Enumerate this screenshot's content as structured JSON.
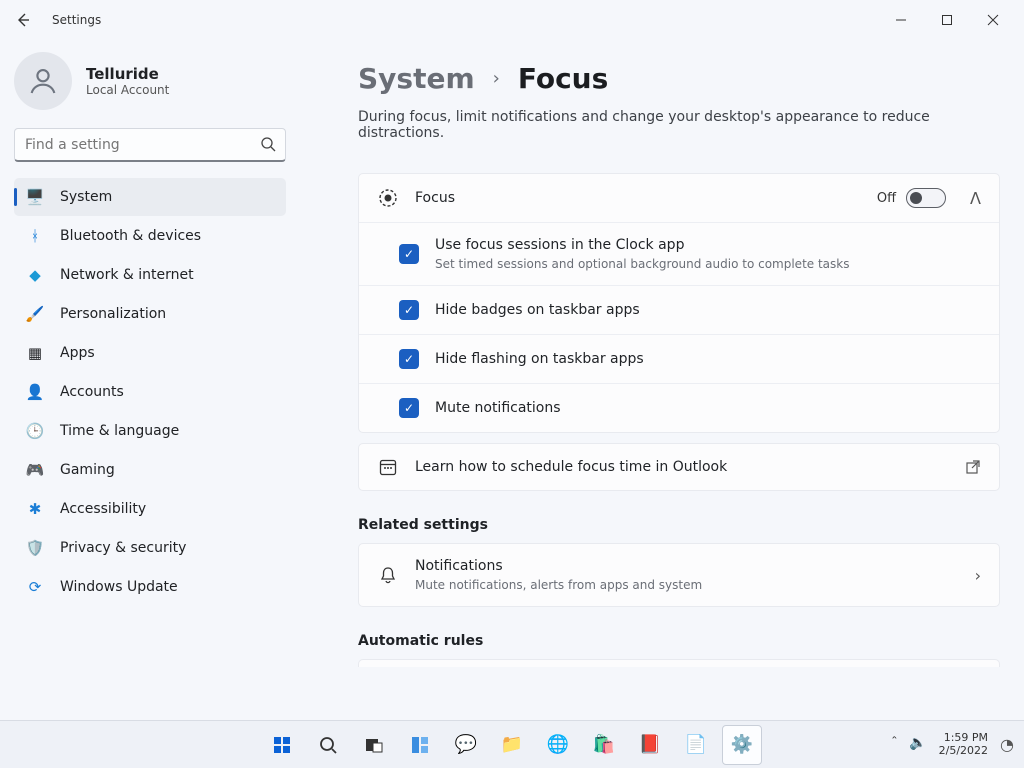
{
  "app": {
    "title": "Settings"
  },
  "user": {
    "name": "Telluride",
    "sub": "Local Account"
  },
  "search": {
    "placeholder": "Find a setting"
  },
  "nav": {
    "items": [
      {
        "label": "System"
      },
      {
        "label": "Bluetooth & devices"
      },
      {
        "label": "Network & internet"
      },
      {
        "label": "Personalization"
      },
      {
        "label": "Apps"
      },
      {
        "label": "Accounts"
      },
      {
        "label": "Time & language"
      },
      {
        "label": "Gaming"
      },
      {
        "label": "Accessibility"
      },
      {
        "label": "Privacy & security"
      },
      {
        "label": "Windows Update"
      }
    ]
  },
  "breadcrumb": {
    "parent": "System",
    "current": "Focus"
  },
  "page": {
    "description": "During focus, limit notifications and change your desktop's appearance to reduce distractions.",
    "focus": {
      "title": "Focus",
      "state_label": "Off",
      "options": [
        {
          "label": "Use focus sessions in the Clock app",
          "sub": "Set timed sessions and optional background audio to complete tasks"
        },
        {
          "label": "Hide badges on taskbar apps"
        },
        {
          "label": "Hide flashing on taskbar apps"
        },
        {
          "label": "Mute notifications"
        }
      ]
    },
    "outlook": {
      "label": "Learn how to schedule focus time in Outlook"
    },
    "related_header": "Related settings",
    "notifications": {
      "title": "Notifications",
      "sub": "Mute notifications, alerts from apps and system"
    },
    "automatic_header": "Automatic rules"
  },
  "taskbar": {
    "time": "1:59 PM",
    "date": "2/5/2022"
  }
}
